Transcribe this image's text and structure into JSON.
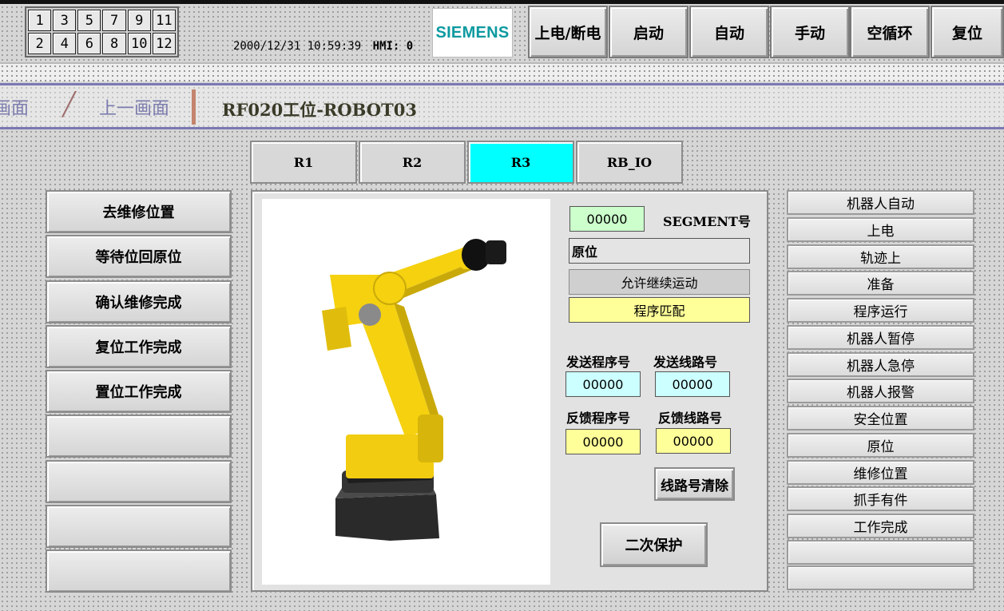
{
  "header": {
    "screen_keys_row1": [
      "1",
      "3",
      "5",
      "7",
      "9",
      "11"
    ],
    "screen_keys_row2": [
      "2",
      "4",
      "6",
      "8",
      "10",
      "12"
    ],
    "datetime": "2000/12/31 10:59:39",
    "hmi_label": "HMI:",
    "hmi_value": "0",
    "logo_text": "SIEMENS",
    "buttons": [
      "上电/断电",
      "启动",
      "自动",
      "手动",
      "空循环",
      "复位"
    ]
  },
  "nav": {
    "prev_screen": "画面",
    "up_screen": "上一画面",
    "title": "RF020工位-ROBOT03"
  },
  "tabs": [
    "R1",
    "R2",
    "R3",
    "RB_IO"
  ],
  "active_tab": "R3",
  "left_buttons": [
    "去维修位置",
    "等待位回原位",
    "确认维修完成",
    "复位工作完成",
    "置位工作完成",
    "",
    "",
    "",
    ""
  ],
  "center": {
    "segment_value": "00000",
    "segment_label": "SEGMENT号",
    "position_text": "原位",
    "allow_continue": "允许继续运动",
    "program_match": "程序匹配",
    "send_program_label": "发送程序号",
    "send_line_label": "发送线路号",
    "send_program_value": "00000",
    "send_line_value": "00000",
    "feedback_program_label": "反馈程序号",
    "feedback_line_label": "反馈线路号",
    "feedback_program_value": "00000",
    "feedback_line_value": "00000",
    "clear_line_button": "线路号清除",
    "secondary_protect_button": "二次保护"
  },
  "status_list": [
    "机器人自动",
    "上电",
    "轨迹上",
    "准备",
    "程序运行",
    "机器人暂停",
    "机器人急停",
    "机器人报警",
    "安全位置",
    "原位",
    "维修位置",
    "抓手有件",
    "工作完成",
    "",
    ""
  ],
  "colors": {
    "active_tab": "#00ffff",
    "segment_field": "#ccffcc",
    "send_field": "#ccffff",
    "feedback_field": "#ffff99",
    "program_match": "#ffff99",
    "logo": "#0c9aa0",
    "robot_yellow": "#f5d10f"
  }
}
